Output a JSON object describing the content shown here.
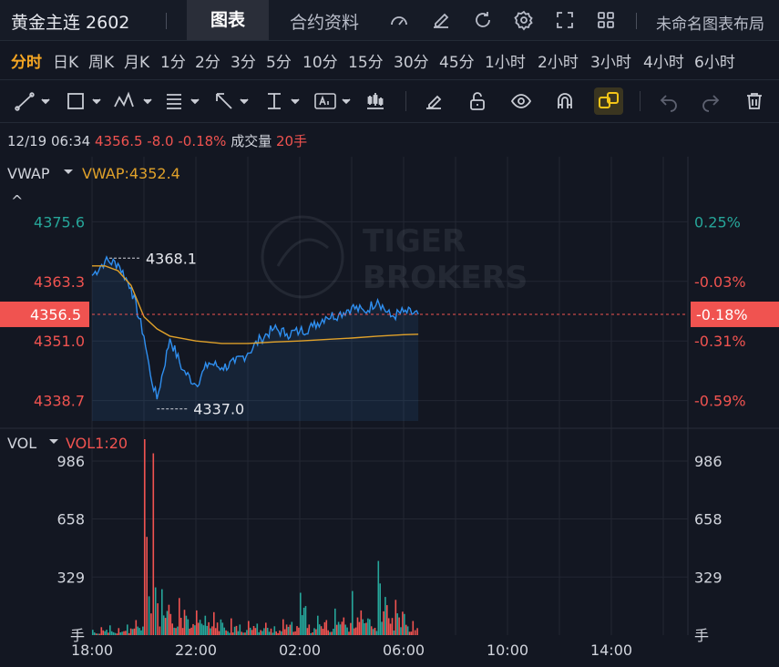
{
  "header": {
    "title": "黄金主连 2602",
    "tab_chart": "图表",
    "tab_contract": "合约资料",
    "layout_name": "未命名图表布局",
    "icons": [
      "speed-gauge-icon",
      "edit-pencil-icon",
      "refresh-icon",
      "settings-gear-icon",
      "fullscreen-icon",
      "grid-layout-icon"
    ]
  },
  "periods": [
    "分时",
    "日K",
    "周K",
    "月K",
    "1分",
    "2分",
    "3分",
    "5分",
    "10分",
    "15分",
    "30分",
    "45分",
    "1小时",
    "2小时",
    "3小时",
    "4小时",
    "6小时"
  ],
  "active_period": "分时",
  "toolbar_icons": [
    "trend-line-icon",
    "rectangle-icon",
    "pattern-icon",
    "fibonacci-icon",
    "arrow-icon",
    "measure-icon",
    "text-note-icon",
    "candle-icon",
    "brush-icon",
    "lock-icon",
    "eye-icon",
    "magnet-icon",
    "link-icon",
    "undo-icon",
    "redo-icon",
    "trash-icon"
  ],
  "quote": {
    "datetime": "12/19 06:34",
    "price": "4356.5",
    "change": "-8.0",
    "change_pct": "-0.18%",
    "volume_label": "成交量",
    "volume": "20手"
  },
  "indicator": {
    "name": "VWAP",
    "value_label": "VWAP:4352.4",
    "collapse_symbol": "^"
  },
  "colors": {
    "up": "#26a69a",
    "down": "#f05350",
    "price_line": "#2f8ff0",
    "vwap_line": "#e0a12a",
    "accent": "#f5a623"
  },
  "watermark": {
    "line1": "TIGER",
    "line2": "BROKERS"
  },
  "chart_data": [
    {
      "type": "line",
      "pane": "price",
      "series": [
        {
          "name": "price",
          "x": [
            "18:00",
            "18:30",
            "19:00",
            "19:30",
            "20:00",
            "20:15",
            "20:30",
            "21:00",
            "21:30",
            "22:00",
            "22:30",
            "23:00",
            "23:30",
            "00:00",
            "00:30",
            "01:00",
            "01:30",
            "02:00",
            "02:30",
            "03:00",
            "03:30",
            "04:00",
            "04:30",
            "05:00",
            "05:30",
            "06:00",
            "06:34"
          ],
          "values": [
            4364.5,
            4367.5,
            4367.0,
            4362.0,
            4352.0,
            4344.0,
            4339.0,
            4351.5,
            4345.0,
            4342.0,
            4346.5,
            4345.5,
            4346.5,
            4348.5,
            4351.5,
            4353.5,
            4352.5,
            4353.0,
            4354.0,
            4356.0,
            4356.5,
            4358.0,
            4357.0,
            4359.5,
            4356.0,
            4357.0,
            4356.5
          ]
        },
        {
          "name": "VWAP",
          "x": [
            "18:00",
            "18:30",
            "19:00",
            "19:30",
            "20:00",
            "20:30",
            "21:00",
            "21:30",
            "22:00",
            "23:00",
            "00:00",
            "01:00",
            "02:00",
            "03:00",
            "04:00",
            "05:00",
            "06:00",
            "06:34"
          ],
          "values": [
            4366.5,
            4366.5,
            4365.5,
            4362.5,
            4356.0,
            4353.5,
            4352.0,
            4351.5,
            4351.0,
            4350.5,
            4350.5,
            4350.8,
            4351.0,
            4351.3,
            4351.6,
            4352.0,
            4352.3,
            4352.4
          ]
        }
      ],
      "y_ticks": [
        "4375.6",
        "4363.3",
        "4351.0",
        "4338.7"
      ],
      "pct_ticks": [
        "0.25%",
        "-0.03%",
        "-0.31%",
        "-0.59%"
      ],
      "ylim": [
        4334.5,
        4381.5
      ],
      "current_price": "4356.5",
      "current_pct": "-0.18%",
      "high_label": "4368.1",
      "low_label": "4337.0"
    },
    {
      "type": "bar",
      "pane": "volume",
      "title": "VOL",
      "subtitle": "VOL1:20",
      "y_ticks": [
        "986",
        "658",
        "329",
        "手"
      ],
      "ylim": [
        0,
        1110
      ],
      "categories": [
        "18:00",
        "18:20",
        "18:40",
        "19:00",
        "19:20",
        "19:40",
        "20:00",
        "20:10",
        "20:20",
        "20:30",
        "20:40",
        "21:00",
        "21:20",
        "21:40",
        "22:00",
        "22:20",
        "22:40",
        "23:00",
        "23:20",
        "23:40",
        "00:00",
        "00:20",
        "00:40",
        "01:00",
        "01:20",
        "01:40",
        "02:00",
        "02:20",
        "02:40",
        "03:00",
        "03:20",
        "03:40",
        "04:00",
        "04:20",
        "04:40",
        "05:00",
        "05:20",
        "05:40",
        "06:00",
        "06:20",
        "06:30"
      ],
      "values": [
        30,
        45,
        55,
        40,
        60,
        85,
        1110,
        220,
        1030,
        180,
        260,
        120,
        210,
        90,
        140,
        110,
        130,
        70,
        95,
        60,
        80,
        65,
        70,
        50,
        90,
        75,
        240,
        60,
        110,
        85,
        150,
        100,
        250,
        140,
        90,
        420,
        170,
        200,
        120,
        80,
        40
      ],
      "directions": [
        "up",
        "down",
        "up",
        "down",
        "up",
        "down",
        "down",
        "up",
        "down",
        "down",
        "up",
        "down",
        "down",
        "up",
        "down",
        "up",
        "down",
        "up",
        "down",
        "up",
        "down",
        "up",
        "down",
        "up",
        "down",
        "up",
        "up",
        "down",
        "up",
        "down",
        "up",
        "down",
        "up",
        "down",
        "up",
        "up",
        "down",
        "down",
        "up",
        "down",
        "down"
      ]
    }
  ],
  "x_axis_labels": [
    "18:00",
    "22:00",
    "02:00",
    "06:00",
    "10:00",
    "14:00"
  ]
}
